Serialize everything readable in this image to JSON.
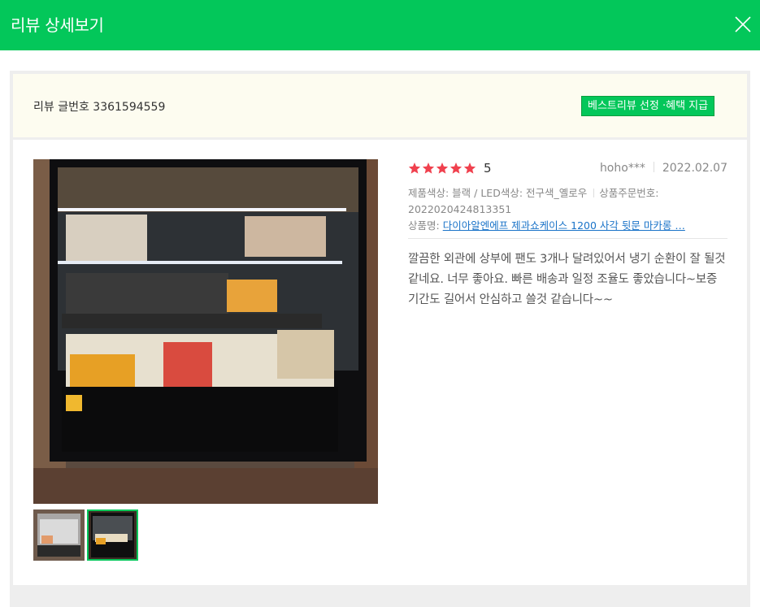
{
  "header": {
    "title": "리뷰 상세보기",
    "close_icon": "close-icon"
  },
  "summary": {
    "review_number": "리뷰 글번호 3361594559",
    "best_badge": "베스트리뷰 선정 ·혜택 지급"
  },
  "review": {
    "rating": 5,
    "rating_text": "5",
    "author": "hoho***",
    "date": "2022.02.07",
    "option_text": "제품색상: 블랙 / LED색상: 전구색_옐로우",
    "order_label": "상품주문번호:",
    "order_number": "2022020424813351",
    "product_label": "상품명:",
    "product_name": "다이아알엔에프 제과쇼케이스 1200 사각 뒷문 마카롱 …",
    "body": "깔끔한 외관에 상부에 팬도 3개나 달려있어서 냉기 순환이 잘 될것 같네요. 너무 좋아요. 빠른 배송과 일정 조율도 좋았습니다~보증기간도 길어서 안심하고 쓸것 같습니다~~"
  },
  "photos": {
    "thumbnails": [
      "thumbnail-1",
      "thumbnail-2"
    ],
    "selected_index": 1
  },
  "colors": {
    "brand": "#03c75a",
    "star": "#f0414e",
    "link": "#1a73c8",
    "summary_bg": "#fdfcf0"
  }
}
